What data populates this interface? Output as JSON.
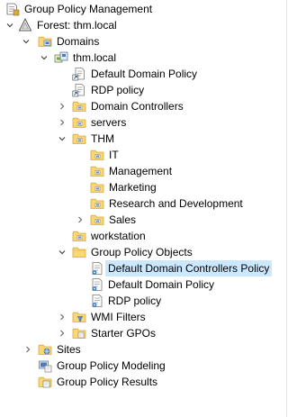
{
  "tree": {
    "root": {
      "label": "Group Policy Management",
      "icon": "gpm-console-icon"
    },
    "forest": {
      "label": "Forest: thm.local",
      "icon": "forest-icon"
    },
    "domains": {
      "label": "Domains",
      "icon": "domains-icon"
    },
    "domain": {
      "label": "thm.local",
      "icon": "domain-icon"
    },
    "default_domain_policy_link": {
      "label": "Default Domain Policy",
      "icon": "gpo-link-icon"
    },
    "rdp_policy_link": {
      "label": "RDP policy",
      "icon": "gpo-link-icon"
    },
    "domain_controllers": {
      "label": "Domain Controllers",
      "icon": "ou-folder-icon"
    },
    "servers": {
      "label": "servers",
      "icon": "ou-folder-icon"
    },
    "thm": {
      "label": "THM",
      "icon": "ou-folder-icon"
    },
    "it": {
      "label": "IT",
      "icon": "ou-folder-icon"
    },
    "management": {
      "label": "Management",
      "icon": "ou-folder-icon"
    },
    "marketing": {
      "label": "Marketing",
      "icon": "ou-folder-icon"
    },
    "research": {
      "label": "Research and Development",
      "icon": "ou-folder-icon"
    },
    "sales": {
      "label": "Sales",
      "icon": "ou-folder-icon"
    },
    "workstation": {
      "label": "workstation",
      "icon": "ou-folder-icon"
    },
    "gpo_container": {
      "label": "Group Policy Objects",
      "icon": "gpo-folder-icon"
    },
    "gpo_default_dc_policy": {
      "label": "Default Domain Controllers Policy",
      "icon": "gpo-icon",
      "selected": true
    },
    "gpo_default_domain_policy": {
      "label": "Default Domain Policy",
      "icon": "gpo-icon"
    },
    "gpo_rdp_policy": {
      "label": "RDP policy",
      "icon": "gpo-icon"
    },
    "wmi_filters": {
      "label": "WMI Filters",
      "icon": "wmi-folder-icon"
    },
    "starter_gpos": {
      "label": "Starter GPOs",
      "icon": "starter-gpo-folder-icon"
    },
    "sites": {
      "label": "Sites",
      "icon": "sites-icon"
    },
    "modeling": {
      "label": "Group Policy Modeling",
      "icon": "gp-modeling-icon"
    },
    "results": {
      "label": "Group Policy Results",
      "icon": "gp-results-icon"
    }
  },
  "colors": {
    "selection": "#cce8ff",
    "folder": "#f8d775",
    "folder_edge": "#d9a93a"
  }
}
